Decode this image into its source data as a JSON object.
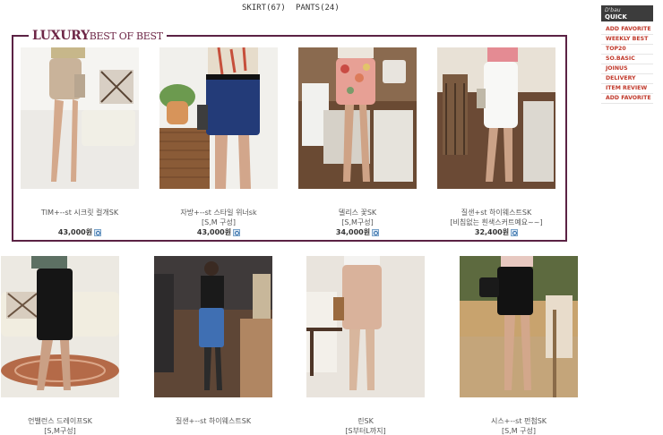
{
  "tabs": [
    {
      "label": "SKIRT(67)"
    },
    {
      "label": "PANTS(24)"
    }
  ],
  "luxury_section": {
    "title_big": "LUXURY",
    "title_small": "BEST OF BEST",
    "accent_color": "#5b2244",
    "products": [
      {
        "name": "TIM+--st 시크릿 컬개SK",
        "option": "",
        "price": "43,000원"
      },
      {
        "name": "자방+--st 스타일 위너sk",
        "option": "[S,M 구성]",
        "price": "43,000원"
      },
      {
        "name": "델리스 꽃SK",
        "option": "[S,M구성]",
        "price": "34,000원"
      },
      {
        "name": "질샌+st 하이웨스트SK",
        "option": "[비침없는 흰색스커트예요~~]",
        "price": "32,400원"
      }
    ]
  },
  "products": [
    {
      "name": "언밸런스 드레이프SK",
      "option": "[S,M구성]"
    },
    {
      "name": "질샌+--st 하이웨스트SK",
      "option": ""
    },
    {
      "name": "린SK",
      "option": "[S부터L까지]"
    },
    {
      "name": "시스+--st 펀첨SK",
      "option": "[S,M 구성]"
    }
  ],
  "quick_menu": {
    "brand": "D'bau",
    "title": "QUICK MENU",
    "items": [
      {
        "label": "ADD FAVORITE"
      },
      {
        "label": "WEEKLY BEST"
      },
      {
        "label": "TOP20"
      },
      {
        "label": "SO.BASIC"
      },
      {
        "label": "JOINUS"
      },
      {
        "label": "DELIVERY"
      },
      {
        "label": "ITEM REVIEW"
      },
      {
        "label": "ADD FAVORITE"
      }
    ],
    "accent_color": "#c0392b"
  }
}
